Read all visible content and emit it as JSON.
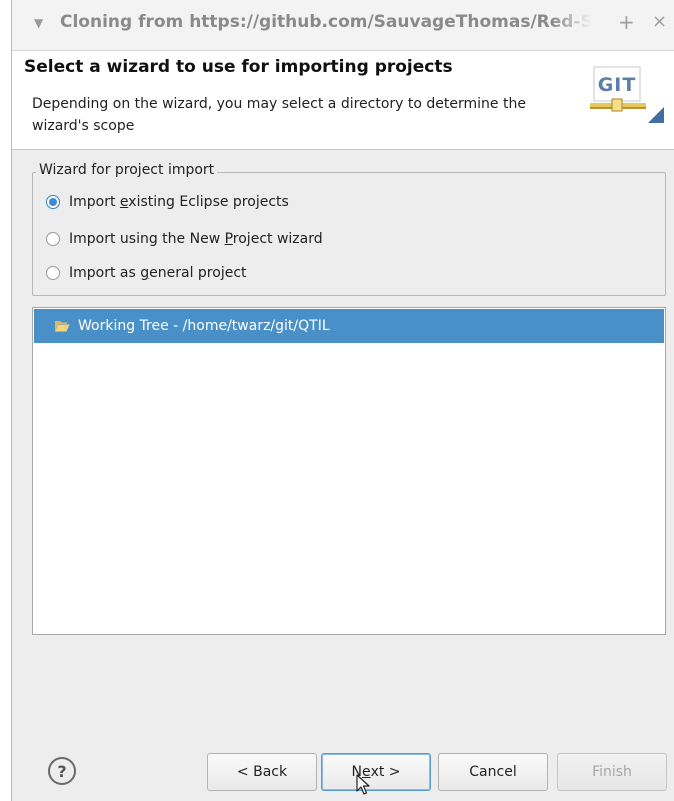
{
  "window": {
    "title": "Cloning from https://github.com/SauvageThomas/Red-S",
    "add_glyph": "+",
    "close_glyph": "×",
    "menu_glyph": "▼"
  },
  "header": {
    "title": "Select a wizard to use for importing projects",
    "description": "Depending on the wizard, you may select a directory to determine the wizard's scope",
    "logo_text": "GIT"
  },
  "wizard_group": {
    "legend": "Wizard for project import",
    "options": [
      {
        "label_pre": "Import ",
        "mnemonic": "e",
        "label_post": "xisting Eclipse projects",
        "checked": true
      },
      {
        "label_pre": "Import using the New ",
        "mnemonic": "P",
        "label_post": "roject wizard",
        "checked": false
      },
      {
        "label_pre": "Import as ",
        "mnemonic": "g",
        "label_post": "eneral project",
        "checked": false
      }
    ]
  },
  "tree": {
    "items": [
      {
        "label": "Working Tree - /home/twarz/git/QTIL",
        "icon": "folder-open-icon",
        "selected": true
      }
    ]
  },
  "buttons": {
    "help": "?",
    "back": "< Back",
    "next_pre": "N",
    "next_mnemonic": "e",
    "next_post": "xt >",
    "cancel": "Cancel",
    "finish": "Finish"
  },
  "colors": {
    "selection": "#4a90c8",
    "radio_accent": "#3d8bd4",
    "logo_text": "#5b7fa6",
    "logo_bar": "#c9a93a"
  }
}
